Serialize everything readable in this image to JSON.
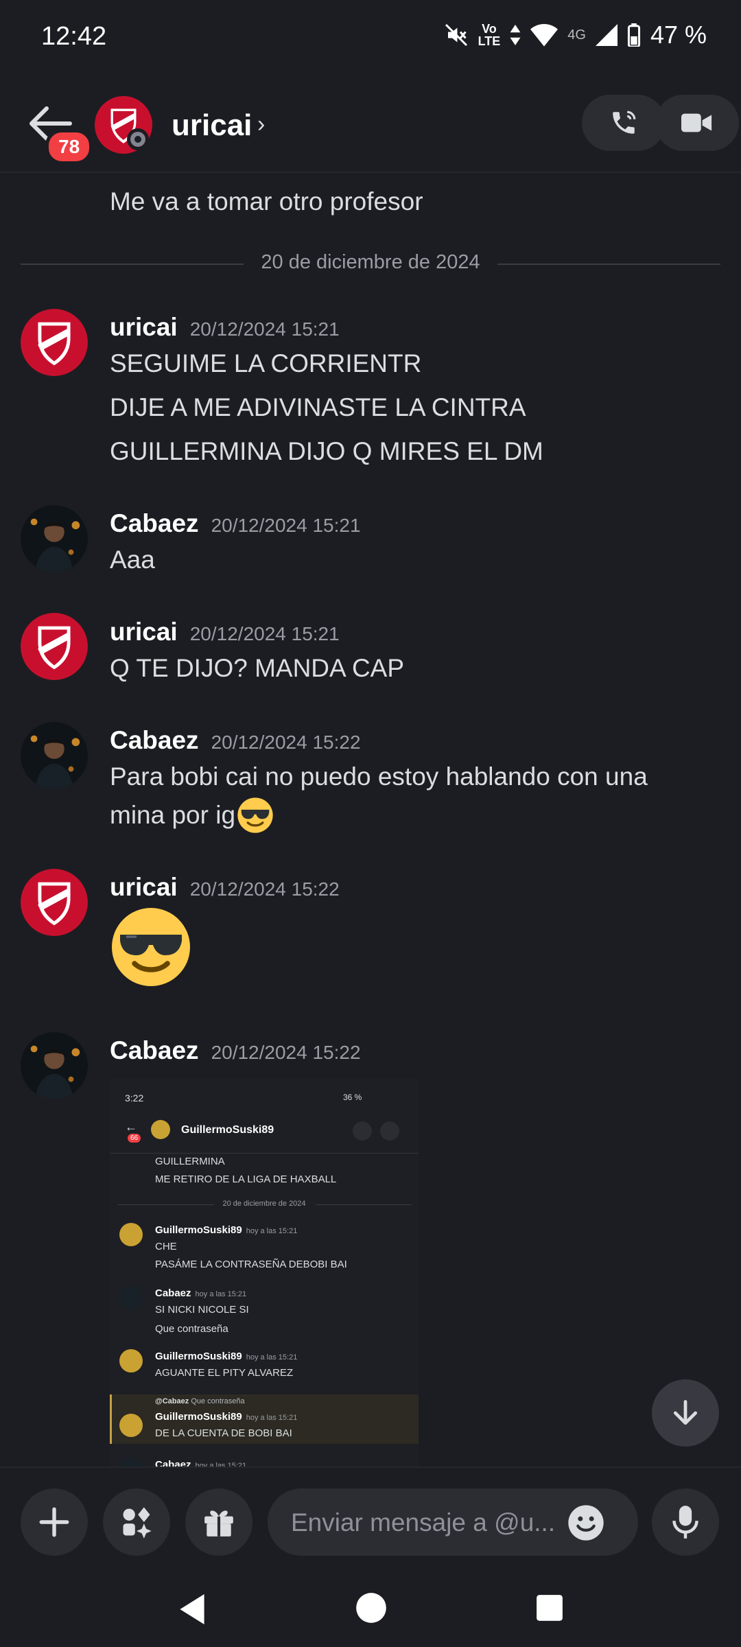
{
  "status_bar": {
    "time": "12:42",
    "volte": "Vo",
    "lte": "LTE",
    "net": "4G",
    "battery": "47 %"
  },
  "header": {
    "name": "uricai",
    "unread_badge": "78",
    "chevron": "›"
  },
  "messages": {
    "prev_text": "Me va a tomar otro profesor",
    "date_divider": "20 de diciembre de 2024",
    "m1": {
      "author": "uricai",
      "time": "20/12/2024 15:21",
      "lines": [
        "SEGUIME LA CORRIENTR",
        "DIJE A ME ADIVINASTE LA CINTRA",
        "GUILLERMINA DIJO Q MIRES EL DM"
      ]
    },
    "m2": {
      "author": "Cabaez",
      "time": "20/12/2024 15:21",
      "text": "Aaa"
    },
    "m3": {
      "author": "uricai",
      "time": "20/12/2024 15:21",
      "text": "Q TE DIJO? MANDA CAP"
    },
    "m4": {
      "author": "Cabaez",
      "time": "20/12/2024 15:22",
      "line1": "Para bobi cai no puedo estoy hablando con una",
      "line2": "mina por ig"
    },
    "m5": {
      "author": "uricai",
      "time": "20/12/2024 15:22",
      "emoji": "sunglasses-emoji"
    },
    "m6": {
      "author": "Cabaez",
      "time": "20/12/2024 15:22"
    }
  },
  "attachment": {
    "time": "3:22",
    "battery": "36 %",
    "title": "GuillermoSuski89",
    "badge": "66",
    "lines": {
      "l1": "GUILLERMINA",
      "l2": "ME RETIRO DE LA LIGA DE HAXBALL",
      "divider": "20 de diciembre de 2024",
      "a1": "GuillermoSuski89",
      "a1t": "hoy a las 15:21",
      "a1l1": "CHE",
      "a1l2": "PASÁME LA CONTRASEÑA DEBOBI BAI",
      "a2": "Cabaez",
      "a2t": "hoy a las 15:21",
      "a2l1": "SI NICKI NICOLE SI",
      "a2l2": "Que contraseña",
      "a3": "GuillermoSuski89",
      "a3t": "hoy a las 15:21",
      "a3l1": "AGUANTE EL PITY ALVAREZ",
      "reply_to": "@Cabaez",
      "reply_text": "Que contraseña",
      "a4": "GuillermoSuski89",
      "a4t": "hoy a las 15:21",
      "a4l1": "DE LA CUENTA DE BOBI BAI",
      "a5": "Cabaez",
      "a5t": "hoy a las 15:21"
    }
  },
  "composer": {
    "placeholder": "Enviar mensaje a @u..."
  },
  "colors": {
    "bg": "#1c1d22",
    "badge": "#f23f43",
    "accent_red": "#c8102e"
  }
}
